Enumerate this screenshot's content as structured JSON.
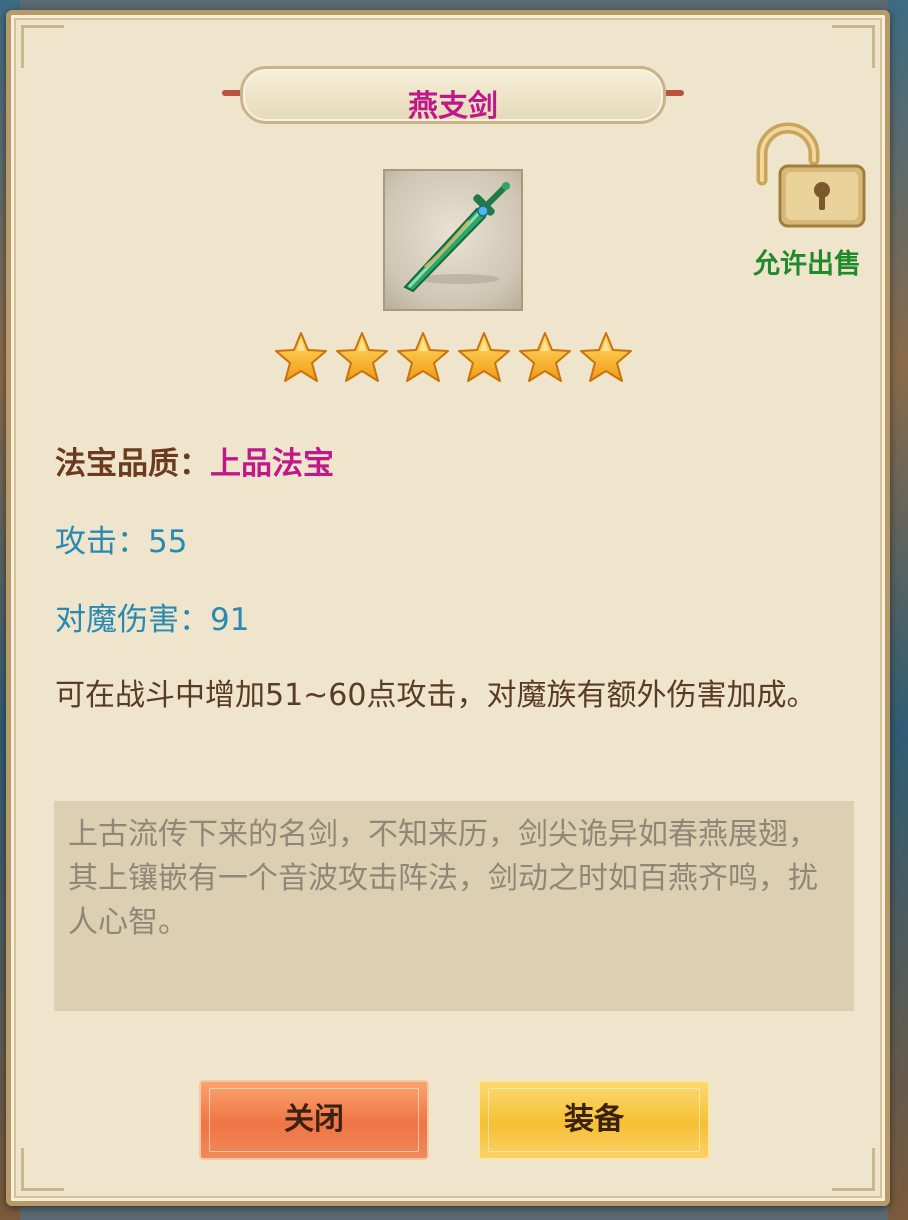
{
  "item": {
    "name": "燕支剑",
    "icon": "green-sword-icon",
    "stars": 6,
    "quality_label": "法宝品质：",
    "quality_value": "上品法宝",
    "stats": [
      {
        "label": "攻击：",
        "value": "55"
      },
      {
        "label": "对魔伤害：",
        "value": "91"
      }
    ],
    "effect_description": "可在战斗中增加51~60点攻击，对魔族有额外伤害加成。",
    "lore": "上古流传下来的名剑，不知来历，剑尖诡异如春燕展翅，其上镶嵌有一个音波攻击阵法，剑动之时如百燕齐鸣，扰人心智。"
  },
  "sell_status": {
    "label": "允许出售",
    "icon": "unlocked-padlock-icon"
  },
  "buttons": {
    "close": "关闭",
    "equip": "装备"
  },
  "colors": {
    "title": "#c0178a",
    "quality_value": "#c0178a",
    "stat": "#2a89b0",
    "sell_label": "#1e8a2a",
    "close_button": "#f07445",
    "equip_button": "#f6c034"
  }
}
